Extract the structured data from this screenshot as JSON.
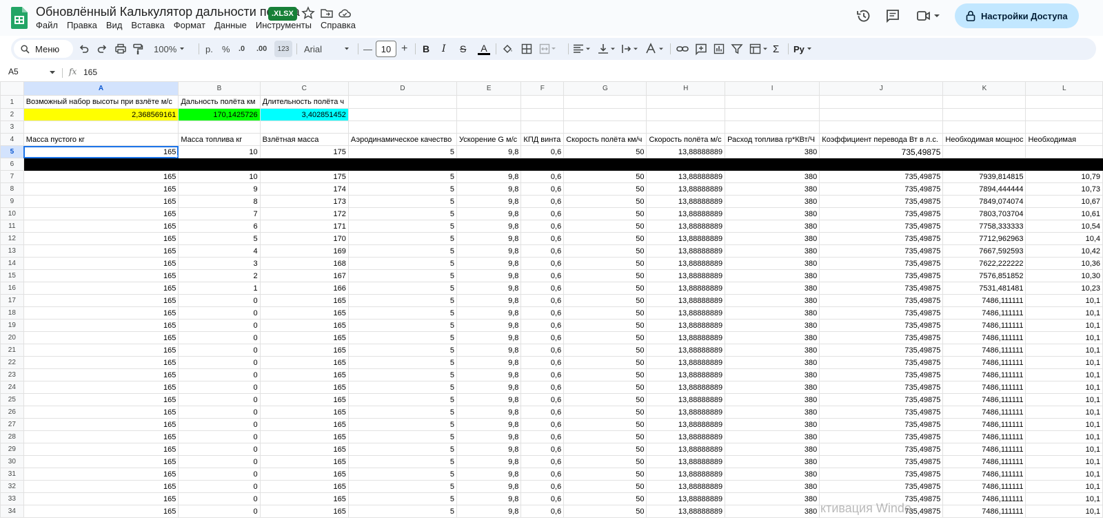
{
  "doc": {
    "title": "Обновлённый Калькулятор дальности полёта",
    "badge": ".XLSX"
  },
  "menu": [
    "Файл",
    "Правка",
    "Вид",
    "Вставка",
    "Формат",
    "Данные",
    "Инструменты",
    "Справка"
  ],
  "share": {
    "label": "Настройки Доступа"
  },
  "toolbar": {
    "search_label": "Меню",
    "zoom": "100%",
    "currency": "р.",
    "percent": "%",
    "dec_decrease": ".0",
    "dec_increase": ".00",
    "format_123": "123",
    "font": "Arial",
    "font_size": "10",
    "minus": "—",
    "plus": "+",
    "bold": "B",
    "italic": "I",
    "strike": "S",
    "text_color": "A",
    "sigma": "Σ",
    "input_tools": "Pу"
  },
  "formula_bar": {
    "cell_ref": "A5",
    "fx": "fx",
    "value": "165"
  },
  "columns": [
    "A",
    "B",
    "C",
    "D",
    "E",
    "F",
    "G",
    "H",
    "I",
    "J",
    "K",
    "L"
  ],
  "row1": [
    "Возможный набор высоты при взлёте м/с",
    "Дальность полёта км",
    "Длительность полёта ч"
  ],
  "row2": [
    "2,368569161",
    "170,1425726",
    "3,402851452"
  ],
  "headers": [
    "Масса пустого кг",
    "Масса топлива кг",
    "Взлётная масса",
    "Аэродинамическое качество",
    "Ускорение G м/с",
    "КПД винта",
    "Скорость полёта км/ч",
    "Скорость полёта м/с",
    "Расход топлива гр*КВт/Ч",
    "Коэффициент перевода Вт в л.с.",
    "Необходимая мощнос",
    "Необходимая"
  ],
  "row5": [
    "165",
    "10",
    "175",
    "5",
    "9,8",
    "0,6",
    "50",
    "13,88888889",
    "380",
    "735,49875",
    "",
    ""
  ],
  "data_rows": [
    [
      "7",
      "165",
      "10",
      "175",
      "5",
      "9,8",
      "0,6",
      "50",
      "13,88888889",
      "380",
      "735,49875",
      "7939,814815",
      "10,79"
    ],
    [
      "8",
      "165",
      "9",
      "174",
      "5",
      "9,8",
      "0,6",
      "50",
      "13,88888889",
      "380",
      "735,49875",
      "7894,444444",
      "10,73"
    ],
    [
      "9",
      "165",
      "8",
      "173",
      "5",
      "9,8",
      "0,6",
      "50",
      "13,88888889",
      "380",
      "735,49875",
      "7849,074074",
      "10,67"
    ],
    [
      "10",
      "165",
      "7",
      "172",
      "5",
      "9,8",
      "0,6",
      "50",
      "13,88888889",
      "380",
      "735,49875",
      "7803,703704",
      "10,61"
    ],
    [
      "11",
      "165",
      "6",
      "171",
      "5",
      "9,8",
      "0,6",
      "50",
      "13,88888889",
      "380",
      "735,49875",
      "7758,333333",
      "10,54"
    ],
    [
      "12",
      "165",
      "5",
      "170",
      "5",
      "9,8",
      "0,6",
      "50",
      "13,88888889",
      "380",
      "735,49875",
      "7712,962963",
      "10,4"
    ],
    [
      "13",
      "165",
      "4",
      "169",
      "5",
      "9,8",
      "0,6",
      "50",
      "13,88888889",
      "380",
      "735,49875",
      "7667,592593",
      "10,42"
    ],
    [
      "14",
      "165",
      "3",
      "168",
      "5",
      "9,8",
      "0,6",
      "50",
      "13,88888889",
      "380",
      "735,49875",
      "7622,222222",
      "10,36"
    ],
    [
      "15",
      "165",
      "2",
      "167",
      "5",
      "9,8",
      "0,6",
      "50",
      "13,88888889",
      "380",
      "735,49875",
      "7576,851852",
      "10,30"
    ],
    [
      "16",
      "165",
      "1",
      "166",
      "5",
      "9,8",
      "0,6",
      "50",
      "13,88888889",
      "380",
      "735,49875",
      "7531,481481",
      "10,23"
    ],
    [
      "17",
      "165",
      "0",
      "165",
      "5",
      "9,8",
      "0,6",
      "50",
      "13,88888889",
      "380",
      "735,49875",
      "7486,111111",
      "10,1"
    ],
    [
      "18",
      "165",
      "0",
      "165",
      "5",
      "9,8",
      "0,6",
      "50",
      "13,88888889",
      "380",
      "735,49875",
      "7486,111111",
      "10,1"
    ],
    [
      "19",
      "165",
      "0",
      "165",
      "5",
      "9,8",
      "0,6",
      "50",
      "13,88888889",
      "380",
      "735,49875",
      "7486,111111",
      "10,1"
    ],
    [
      "20",
      "165",
      "0",
      "165",
      "5",
      "9,8",
      "0,6",
      "50",
      "13,88888889",
      "380",
      "735,49875",
      "7486,111111",
      "10,1"
    ],
    [
      "21",
      "165",
      "0",
      "165",
      "5",
      "9,8",
      "0,6",
      "50",
      "13,88888889",
      "380",
      "735,49875",
      "7486,111111",
      "10,1"
    ],
    [
      "22",
      "165",
      "0",
      "165",
      "5",
      "9,8",
      "0,6",
      "50",
      "13,88888889",
      "380",
      "735,49875",
      "7486,111111",
      "10,1"
    ],
    [
      "23",
      "165",
      "0",
      "165",
      "5",
      "9,8",
      "0,6",
      "50",
      "13,88888889",
      "380",
      "735,49875",
      "7486,111111",
      "10,1"
    ],
    [
      "24",
      "165",
      "0",
      "165",
      "5",
      "9,8",
      "0,6",
      "50",
      "13,88888889",
      "380",
      "735,49875",
      "7486,111111",
      "10,1"
    ],
    [
      "25",
      "165",
      "0",
      "165",
      "5",
      "9,8",
      "0,6",
      "50",
      "13,88888889",
      "380",
      "735,49875",
      "7486,111111",
      "10,1"
    ],
    [
      "26",
      "165",
      "0",
      "165",
      "5",
      "9,8",
      "0,6",
      "50",
      "13,88888889",
      "380",
      "735,49875",
      "7486,111111",
      "10,1"
    ],
    [
      "27",
      "165",
      "0",
      "165",
      "5",
      "9,8",
      "0,6",
      "50",
      "13,88888889",
      "380",
      "735,49875",
      "7486,111111",
      "10,1"
    ],
    [
      "28",
      "165",
      "0",
      "165",
      "5",
      "9,8",
      "0,6",
      "50",
      "13,88888889",
      "380",
      "735,49875",
      "7486,111111",
      "10,1"
    ],
    [
      "29",
      "165",
      "0",
      "165",
      "5",
      "9,8",
      "0,6",
      "50",
      "13,88888889",
      "380",
      "735,49875",
      "7486,111111",
      "10,1"
    ],
    [
      "30",
      "165",
      "0",
      "165",
      "5",
      "9,8",
      "0,6",
      "50",
      "13,88888889",
      "380",
      "735,49875",
      "7486,111111",
      "10,1"
    ],
    [
      "31",
      "165",
      "0",
      "165",
      "5",
      "9,8",
      "0,6",
      "50",
      "13,88888889",
      "380",
      "735,49875",
      "7486,111111",
      "10,1"
    ],
    [
      "32",
      "165",
      "0",
      "165",
      "5",
      "9,8",
      "0,6",
      "50",
      "13,88888889",
      "380",
      "735,49875",
      "7486,111111",
      "10,1"
    ],
    [
      "33",
      "165",
      "0",
      "165",
      "5",
      "9,8",
      "0,6",
      "50",
      "13,88888889",
      "380",
      "735,49875",
      "7486,111111",
      "10,1"
    ],
    [
      "34",
      "165",
      "0",
      "165",
      "5",
      "9,8",
      "0,6",
      "50",
      "13,88888889",
      "380",
      "735,49875",
      "7486,111111",
      "10,1"
    ]
  ],
  "watermark": "ктивация Windo",
  "colors": {
    "yellow": "#ffff00",
    "green": "#00ff00",
    "cyan": "#00ffff",
    "accent": "#1a73e8",
    "share_bg": "#c2e7ff"
  }
}
